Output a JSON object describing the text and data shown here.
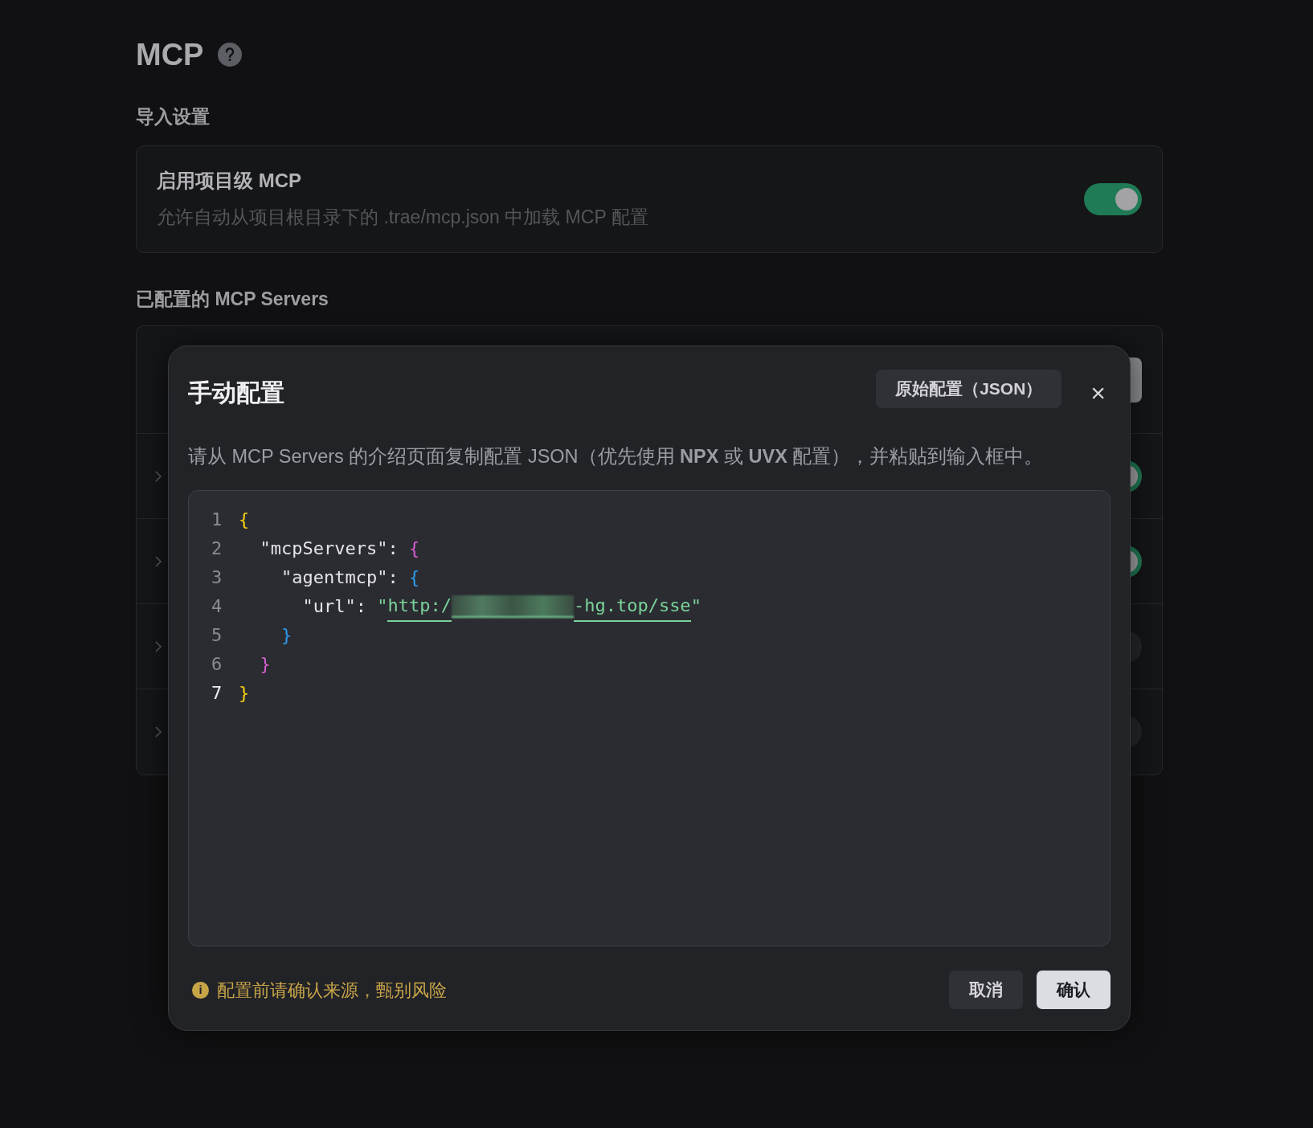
{
  "page": {
    "title": "MCP"
  },
  "import_settings": {
    "heading": "导入设置",
    "title": "启用项目级 MCP",
    "description": "允许自动从项目根目录下的 .trae/mcp.json 中加载 MCP 配置",
    "on": true
  },
  "servers": {
    "heading": "已配置的 MCP Servers",
    "rows": [
      {
        "on": true
      },
      {
        "on": true
      },
      {
        "on": false
      },
      {
        "on": false
      }
    ]
  },
  "dialog": {
    "title": "手动配置",
    "mode_button": "原始配置（JSON）",
    "close": "×",
    "description": "请从 MCP Servers 的介绍页面复制配置 JSON（优先使用 **NPX** 或 **UVX** 配置），并粘贴到输入框中。",
    "editor": {
      "lines": [
        {
          "number": "1",
          "current": false,
          "tokens": [
            {
              "kind": "brace1",
              "text": "{"
            }
          ]
        },
        {
          "number": "2",
          "current": false,
          "tokens": [
            {
              "kind": "plain",
              "text": "  \"mcpServers\": "
            },
            {
              "kind": "brace2",
              "text": "{"
            }
          ]
        },
        {
          "number": "3",
          "current": false,
          "tokens": [
            {
              "kind": "plain",
              "text": "    \"agentmcp\": "
            },
            {
              "kind": "brace3",
              "text": "{"
            }
          ]
        },
        {
          "number": "4",
          "current": false,
          "tokens": [
            {
              "kind": "plain",
              "text": "      \"url\": "
            },
            {
              "kind": "string",
              "text": "\""
            },
            {
              "kind": "link",
              "text": "http:/"
            },
            {
              "kind": "redacted"
            },
            {
              "kind": "link",
              "text": "-hg.top/sse"
            },
            {
              "kind": "string",
              "text": "\""
            }
          ]
        },
        {
          "number": "5",
          "current": false,
          "tokens": [
            {
              "kind": "brace3",
              "text": "    }"
            }
          ]
        },
        {
          "number": "6",
          "current": false,
          "tokens": [
            {
              "kind": "brace2",
              "text": "  }"
            }
          ]
        },
        {
          "number": "7",
          "current": true,
          "tokens": [
            {
              "kind": "brace1",
              "text": "}"
            }
          ]
        }
      ]
    },
    "warning": "配置前请确认来源，甄别风险",
    "warning_icon": "i",
    "buttons": [
      {
        "kind": "secondary",
        "label": "取消"
      },
      {
        "kind": "primary",
        "label": "确认"
      }
    ]
  }
}
